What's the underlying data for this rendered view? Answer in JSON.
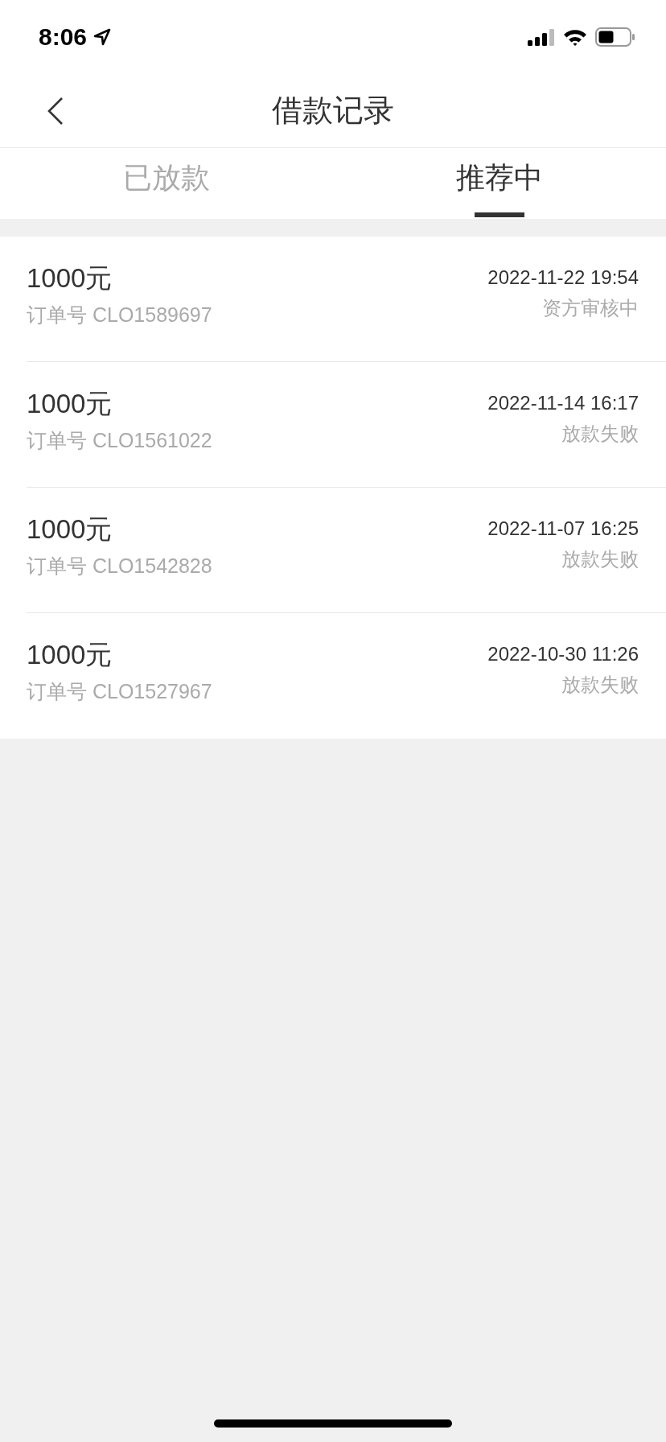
{
  "status_bar": {
    "time": "8:06"
  },
  "header": {
    "title": "借款记录"
  },
  "tabs": [
    {
      "label": "已放款",
      "selected": false
    },
    {
      "label": "推荐中",
      "selected": true
    }
  ],
  "records": [
    {
      "amount": "1000元",
      "order": "订单号 CLO1589697",
      "datetime": "2022-11-22 19:54",
      "status": "资方审核中"
    },
    {
      "amount": "1000元",
      "order": "订单号 CLO1561022",
      "datetime": "2022-11-14 16:17",
      "status": "放款失败"
    },
    {
      "amount": "1000元",
      "order": "订单号 CLO1542828",
      "datetime": "2022-11-07 16:25",
      "status": "放款失败"
    },
    {
      "amount": "1000元",
      "order": "订单号 CLO1527967",
      "datetime": "2022-10-30 11:26",
      "status": "放款失败"
    }
  ]
}
